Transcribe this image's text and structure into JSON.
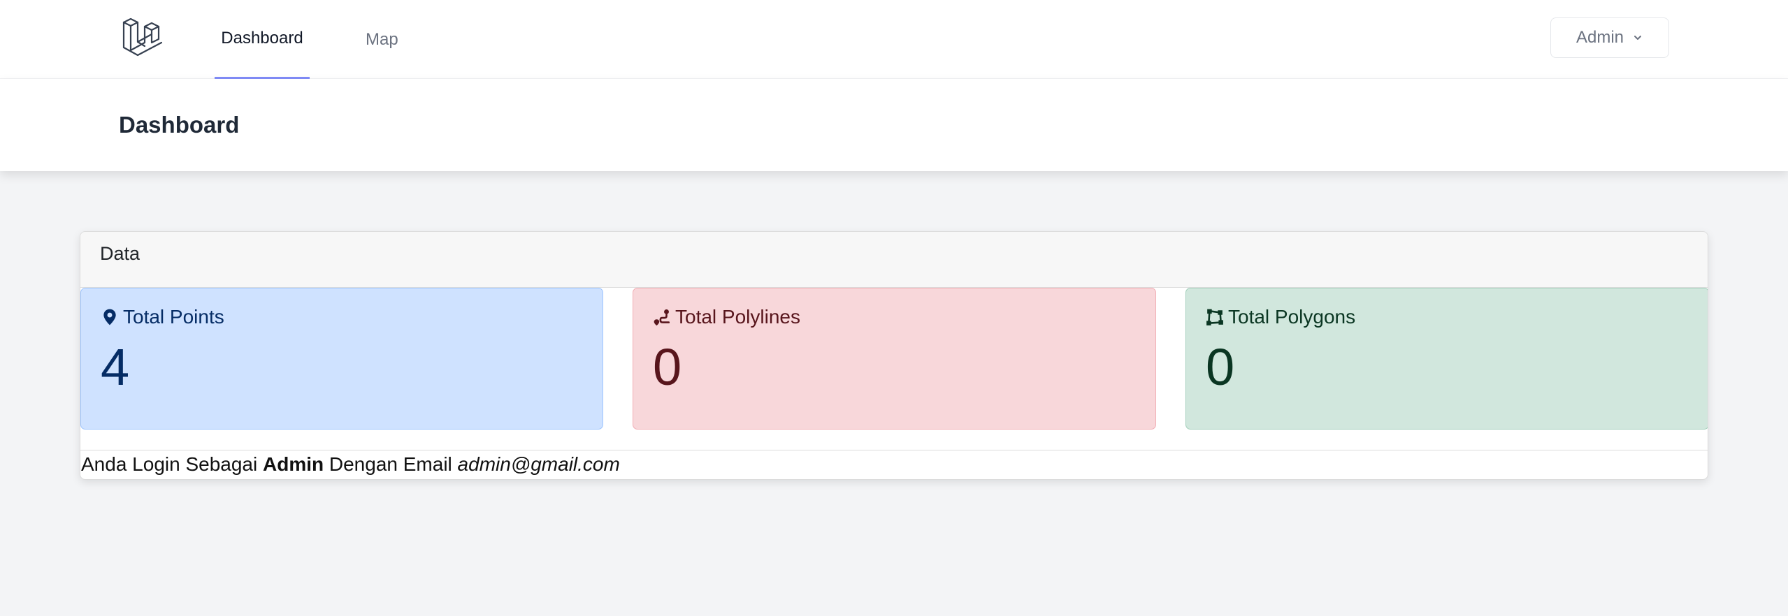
{
  "nav": {
    "logo_icon": "laravel-logo-icon",
    "links": [
      {
        "label": "Dashboard",
        "active": true
      },
      {
        "label": "Map",
        "active": false
      }
    ],
    "user_menu": {
      "label": "Admin",
      "icon": "chevron-down-icon"
    }
  },
  "header": {
    "title": "Dashboard"
  },
  "card": {
    "title": "Data",
    "stats": [
      {
        "label": "Total Points",
        "value": "4",
        "icon": "map-marker-icon",
        "bg": "#cfe2ff",
        "fg": "#052c65"
      },
      {
        "label": "Total Polylines",
        "value": "0",
        "icon": "route-icon",
        "bg": "#f8d7da",
        "fg": "#58151c"
      },
      {
        "label": "Total Polygons",
        "value": "0",
        "icon": "draw-polygon-icon",
        "bg": "#d1e7dd",
        "fg": "#0a3622"
      }
    ],
    "footer": {
      "prefix": "Anda Login Sebagai",
      "role": "Admin",
      "middle": "Dengan Email",
      "email": "admin@gmail.com"
    }
  },
  "colors": {
    "page_bg": "#f3f4f6",
    "nav_active_underline": "#818cf8"
  }
}
